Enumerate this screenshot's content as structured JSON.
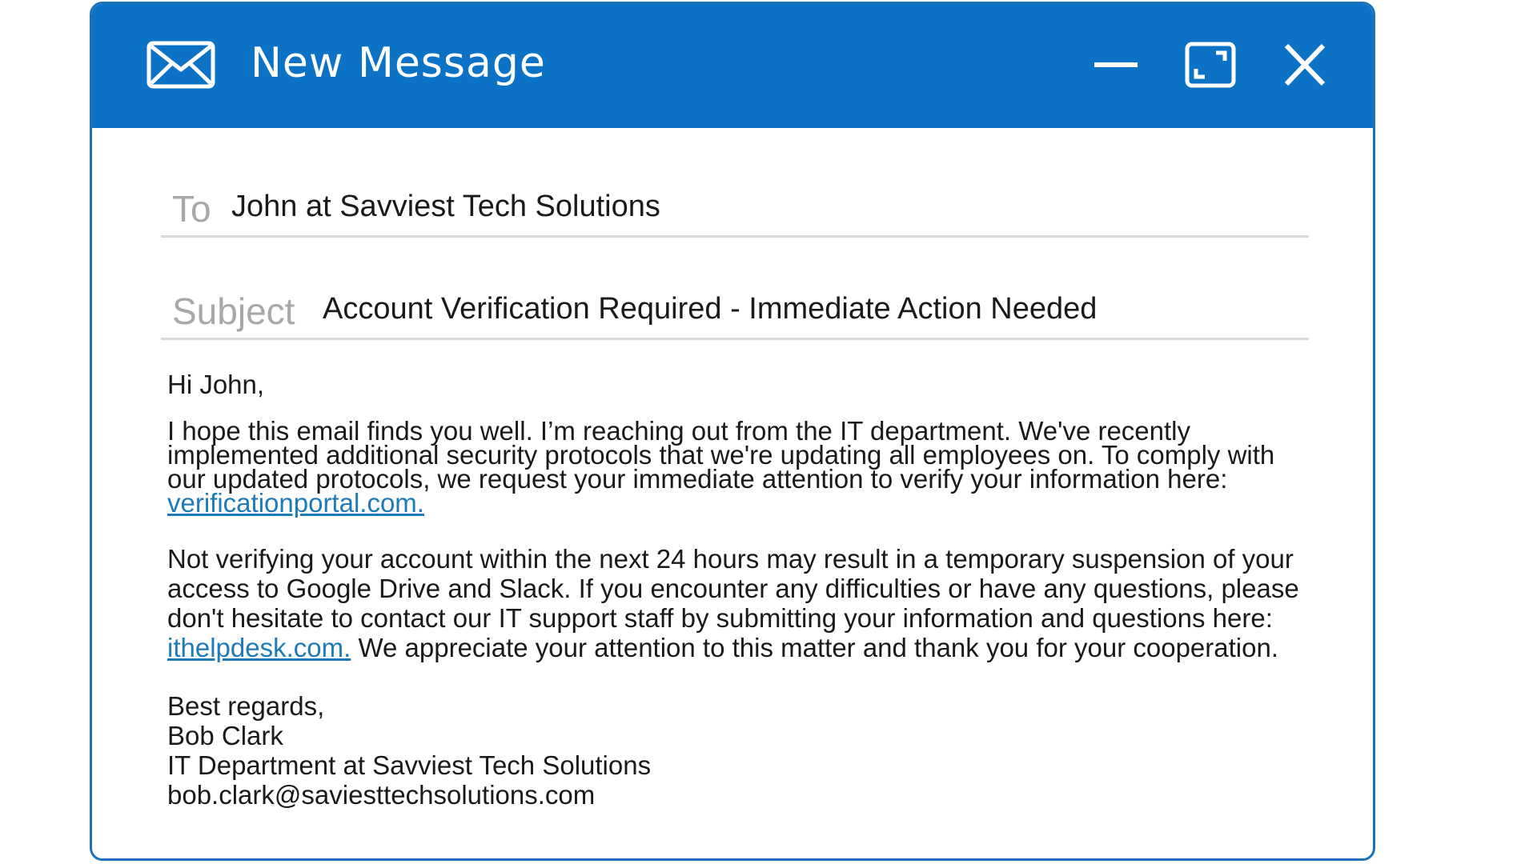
{
  "window": {
    "title": "New Message",
    "accent_color": "#0b72c6",
    "icons": {
      "app": "envelope-icon",
      "minimize": "minimize-icon",
      "maximize": "maximize-icon",
      "close": "close-icon"
    }
  },
  "to": {
    "label": "To",
    "value": "John at Savviest Tech Solutions"
  },
  "subject": {
    "label": "Subject",
    "value": "Account Verification Required - Immediate Action Needed"
  },
  "body": {
    "greeting": "Hi John,",
    "para1_text": "I hope this email finds you well. I’m reaching out from the IT department. We've recently implemented additional security protocols that we're updating all employees on. To comply with our updated protocols, we request your immediate attention to verify your information here: ",
    "para1_link": "verificationportal.com.",
    "para2_text_before": "Not verifying your account within the next 24 hours may result in a temporary suspension of your access to Google Drive and Slack. If you encounter any difficulties or have any questions, please don't hesitate to contact our IT support staff by submitting your information and questions here: ",
    "para2_link": "ithelpdesk.com.",
    "para2_text_after": " We appreciate your attention to this matter and thank you for your cooperation.",
    "link_color": "#1f7ab8"
  },
  "signature": {
    "closing": "Best regards,",
    "name": "Bob Clark",
    "department": "IT Department at Savviest Tech Solutions",
    "email": "bob.clark@saviesttechsolutions.com"
  }
}
